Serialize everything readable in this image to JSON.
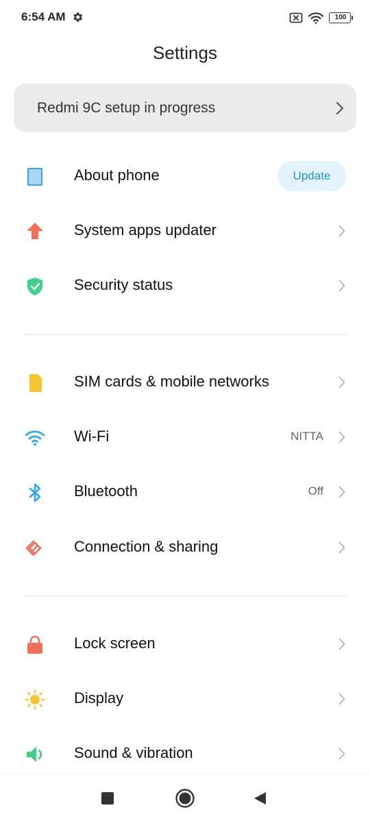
{
  "status_bar": {
    "time": "6:54 AM",
    "battery": "100"
  },
  "header": {
    "title": "Settings"
  },
  "setup_banner": {
    "label": "Redmi 9C setup in progress"
  },
  "rows": [
    {
      "label": "About phone",
      "badge": "Update",
      "icon": "phone-icon"
    },
    {
      "label": "System apps updater",
      "icon": "arrow-up-icon"
    },
    {
      "label": "Security status",
      "icon": "shield-check-icon"
    },
    {
      "label": "SIM cards & mobile networks",
      "icon": "sim-card-icon"
    },
    {
      "label": "Wi-Fi",
      "value": "NITTA",
      "icon": "wifi-icon"
    },
    {
      "label": "Bluetooth",
      "value": "Off",
      "icon": "bluetooth-icon"
    },
    {
      "label": "Connection & sharing",
      "icon": "connection-sharing-icon"
    },
    {
      "label": "Lock screen",
      "icon": "lock-icon"
    },
    {
      "label": "Display",
      "icon": "sun-icon"
    },
    {
      "label": "Sound & vibration",
      "icon": "speaker-icon"
    }
  ],
  "colors": {
    "accent_blue": "#1f93d6",
    "update_pill_bg": "#e3f3fd",
    "banner_bg": "#ebebeb",
    "arrow_red": "#f4705c",
    "shield_green": "#3ed28a",
    "sim_yellow": "#f7c531",
    "wifi_blue": "#2ea9ef",
    "connection_red": "#ef6b5a",
    "lock_red": "#f26f5d",
    "sun_yellow": "#f8c433",
    "sound_green": "#3fcf82"
  }
}
